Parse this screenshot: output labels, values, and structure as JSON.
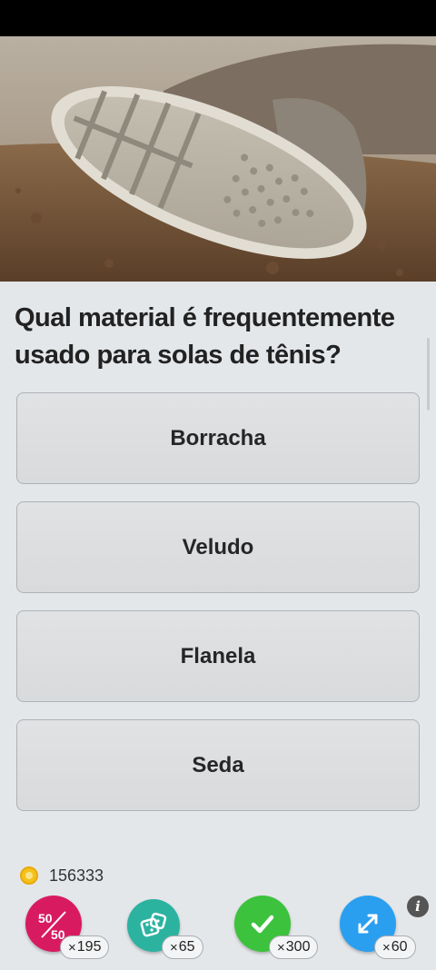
{
  "question": {
    "text": "Qual material é frequentemente usado para solas de tênis?",
    "image_alt": "shoe-sole-photo"
  },
  "answers": [
    {
      "label": "Borracha"
    },
    {
      "label": "Veludo"
    },
    {
      "label": "Flanela"
    },
    {
      "label": "Seda"
    }
  ],
  "coins": {
    "value": "156333",
    "icon": "coin-icon"
  },
  "powerups": [
    {
      "name": "fifty-fifty",
      "icon": "fifty-fifty-icon",
      "glyph_top": "50",
      "glyph_bottom": "50",
      "count": "195",
      "color": "#d81b60"
    },
    {
      "name": "dice",
      "icon": "dice-icon",
      "count": "65",
      "color": "#2bb3a0"
    },
    {
      "name": "correct-answer",
      "icon": "check-icon",
      "count": "300",
      "color": "#3cc23c"
    },
    {
      "name": "swap-question",
      "icon": "swap-icon",
      "count": "60",
      "color": "#2a9ff0"
    }
  ],
  "info": {
    "label": "i"
  },
  "badge_prefix": "×"
}
